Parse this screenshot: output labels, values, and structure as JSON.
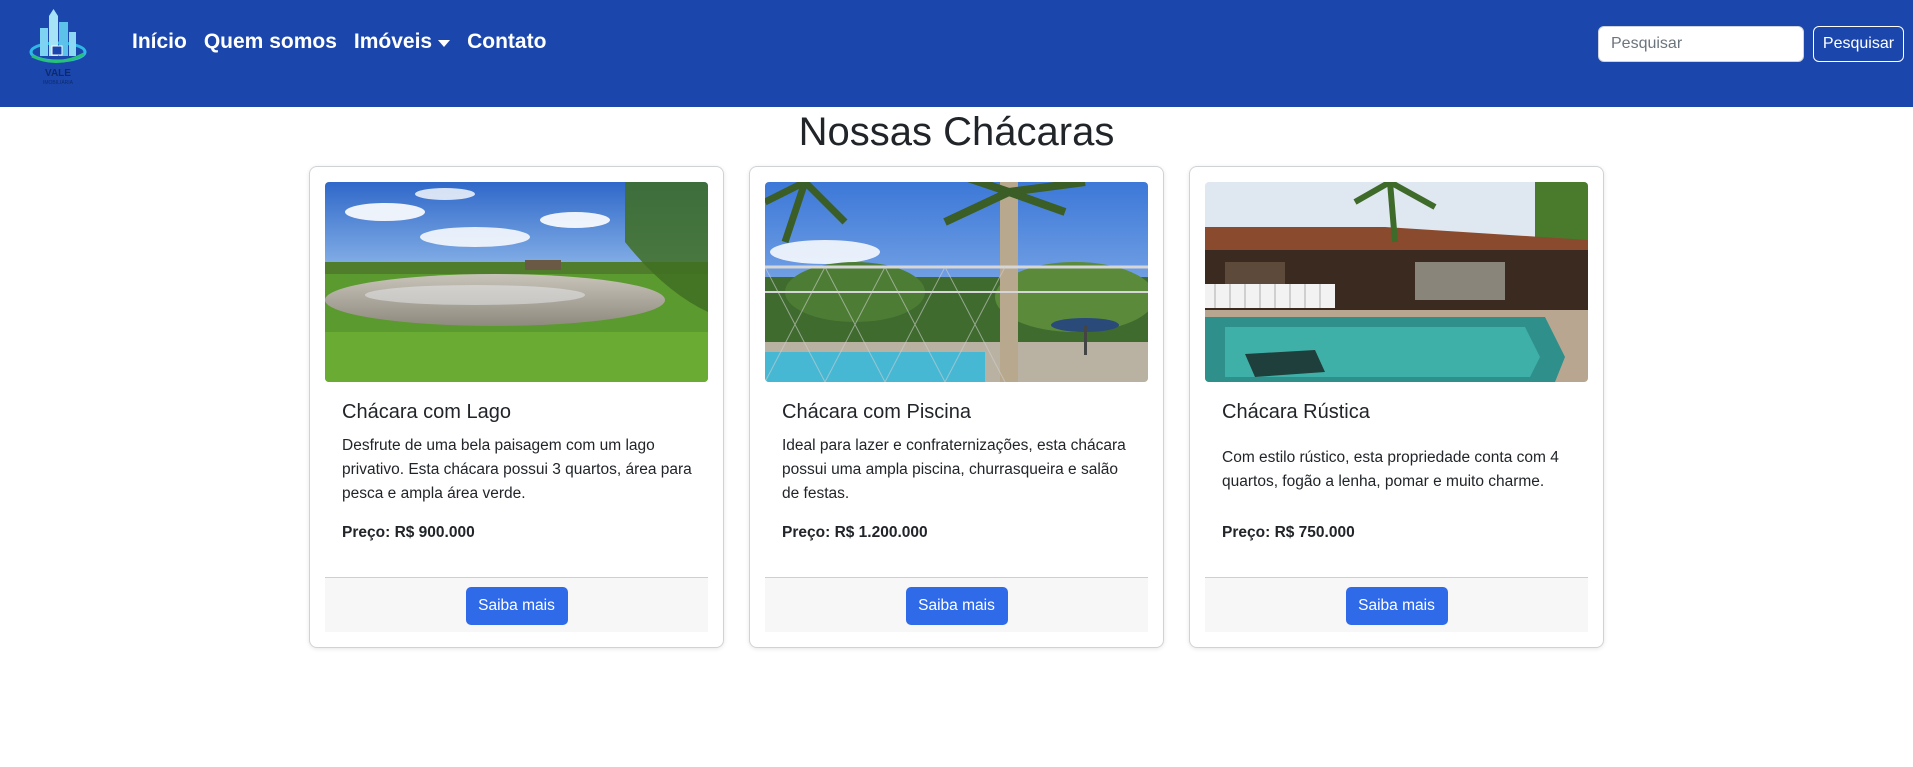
{
  "navbar": {
    "brand": "VALE",
    "brand_sub": "IMOBILIÁRIA",
    "links": [
      {
        "label": "Início"
      },
      {
        "label": "Quem somos"
      },
      {
        "label": "Imóveis",
        "dropdown": true
      },
      {
        "label": "Contato"
      }
    ],
    "search": {
      "placeholder": "Pesquisar",
      "button_label": "Pesquisar"
    },
    "colors": {
      "background": "#1b47ac",
      "text": "#ffffff"
    }
  },
  "page": {
    "title": "Nossas Chácaras"
  },
  "cards": [
    {
      "image": "lake-farm-photo",
      "title": "Chácara com Lago",
      "description": "Desfrute de uma bela paisagem com um lago privativo. Esta chácara possui 3 quartos, área para pesca e ampla área verde.",
      "price_label": "Preço:",
      "price_value": "R$ 900.000",
      "button_label": "Saiba mais"
    },
    {
      "image": "pool-palm-trees-photo",
      "title": "Chácara com Piscina",
      "description": "Ideal para lazer e confraternizações, esta chácara possui uma ampla piscina, churrasqueira e salão de festas.",
      "price_label": "Preço:",
      "price_value": "R$ 1.200.000",
      "button_label": "Saiba mais"
    },
    {
      "image": "rustic-house-pool-photo",
      "title": "Chácara Rústica",
      "description": "Com estilo rústico, esta propriedade conta com 4 quartos, fogão a lenha, pomar e muito charme.",
      "price_label": "Preço:",
      "price_value": "R$ 750.000",
      "button_label": "Saiba mais"
    }
  ],
  "colors": {
    "button": "#2f6ae8",
    "footer_bg": "#f7f7f7"
  }
}
